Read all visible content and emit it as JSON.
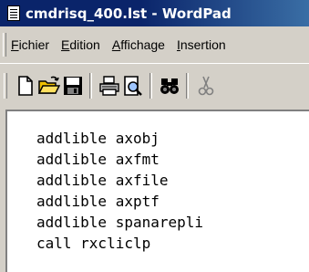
{
  "window": {
    "title": "cmdrisq_400.lst - WordPad",
    "icon": "wordpad-document-icon"
  },
  "menu": {
    "items": [
      {
        "label": "Fichier",
        "accel": "F"
      },
      {
        "label": "Edition",
        "accel": "E"
      },
      {
        "label": "Affichage",
        "accel": "A"
      },
      {
        "label": "Insertion",
        "accel": "I"
      }
    ]
  },
  "toolbar": {
    "buttons": [
      "new-document-icon",
      "open-folder-icon",
      "save-disk-icon",
      "print-icon",
      "print-preview-icon",
      "find-binoculars-icon",
      "cut-scissors-icon"
    ]
  },
  "document": {
    "lines": [
      "addlible axobj",
      "addlible axfmt",
      "addlible axfile",
      "addlible axptf",
      "addlible spanarepli",
      "call rxcliclp"
    ]
  },
  "colors": {
    "title_bar": "#0a246a",
    "chrome": "#d4d0c8",
    "document_bg": "#ffffff"
  }
}
